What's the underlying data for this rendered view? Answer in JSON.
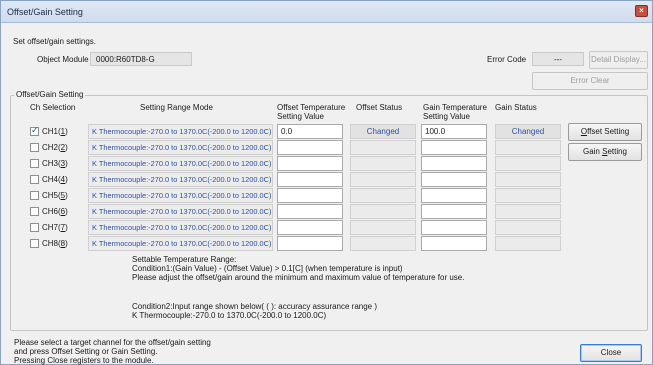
{
  "window": {
    "title": "Offset/Gain Setting",
    "close_glyph": "×"
  },
  "intro": "Set offset/gain settings.",
  "object_module": {
    "label": "Object Module",
    "value": "0000:R60TD8-G"
  },
  "error_code": {
    "label": "Error Code",
    "value": "---"
  },
  "buttons": {
    "detail_display": "Detail Display...",
    "error_clear": "Error Clear",
    "offset_setting": "Offset Setting",
    "gain_setting": "Gain Setting",
    "close": "Close"
  },
  "group_title": "Offset/Gain Setting",
  "headers": {
    "ch_selection": "Ch Selection",
    "setting_range_mode": "Setting Range Mode",
    "offset_temp_line1": "Offset Temperature",
    "offset_temp_line2": "Setting Value",
    "offset_status": "Offset Status",
    "gain_temp_line1": "Gain Temperature",
    "gain_temp_line2": "Setting Value",
    "gain_status": "Gain Status"
  },
  "channels": [
    {
      "name": "CH1",
      "key": "1",
      "checked": true,
      "range": "K Thermocouple:-270.0 to 1370.0C(-200.0 to 1200.0C)",
      "offset": "0.0",
      "offset_status": "Changed",
      "gain": "100.0",
      "gain_status": "Changed"
    },
    {
      "name": "CH2",
      "key": "2",
      "checked": false,
      "range": "K Thermocouple:-270.0 to 1370.0C(-200.0 to 1200.0C)",
      "offset": "",
      "offset_status": "",
      "gain": "",
      "gain_status": ""
    },
    {
      "name": "CH3",
      "key": "3",
      "checked": false,
      "range": "K Thermocouple:-270.0 to 1370.0C(-200.0 to 1200.0C)",
      "offset": "",
      "offset_status": "",
      "gain": "",
      "gain_status": ""
    },
    {
      "name": "CH4",
      "key": "4",
      "checked": false,
      "range": "K Thermocouple:-270.0 to 1370.0C(-200.0 to 1200.0C)",
      "offset": "",
      "offset_status": "",
      "gain": "",
      "gain_status": ""
    },
    {
      "name": "CH5",
      "key": "5",
      "checked": false,
      "range": "K Thermocouple:-270.0 to 1370.0C(-200.0 to 1200.0C)",
      "offset": "",
      "offset_status": "",
      "gain": "",
      "gain_status": ""
    },
    {
      "name": "CH6",
      "key": "6",
      "checked": false,
      "range": "K Thermocouple:-270.0 to 1370.0C(-200.0 to 1200.0C)",
      "offset": "",
      "offset_status": "",
      "gain": "",
      "gain_status": ""
    },
    {
      "name": "CH7",
      "key": "7",
      "checked": false,
      "range": "K Thermocouple:-270.0 to 1370.0C(-200.0 to 1200.0C)",
      "offset": "",
      "offset_status": "",
      "gain": "",
      "gain_status": ""
    },
    {
      "name": "CH8",
      "key": "8",
      "checked": false,
      "range": "K Thermocouple:-270.0 to 1370.0C(-200.0 to 1200.0C)",
      "offset": "",
      "offset_status": "",
      "gain": "",
      "gain_status": ""
    }
  ],
  "notes": {
    "line1": "Settable  Temperature  Range:",
    "line2": "Condition1:(Gain Value) - (Offset Value) > 0.1[C] (when temperature is input)",
    "line3": "Please adjust the offset/gain around the minimum and maximum value of temperature for use.",
    "line4": "Condition2:Input range shown below( ( ): accuracy assurance range )",
    "line5": "K Thermocouple:-270.0 to 1370.0C(-200.0 to 1200.0C)"
  },
  "footer": {
    "line1": "Please select a target channel for the offset/gain setting",
    "line2": "and press Offset Setting or Gain Setting.",
    "line3": "Pressing Close registers to the module."
  },
  "colors": {
    "link_blue": "#2d51a7",
    "title_bg": "#cfdcee",
    "close_red": "#c7503f"
  }
}
